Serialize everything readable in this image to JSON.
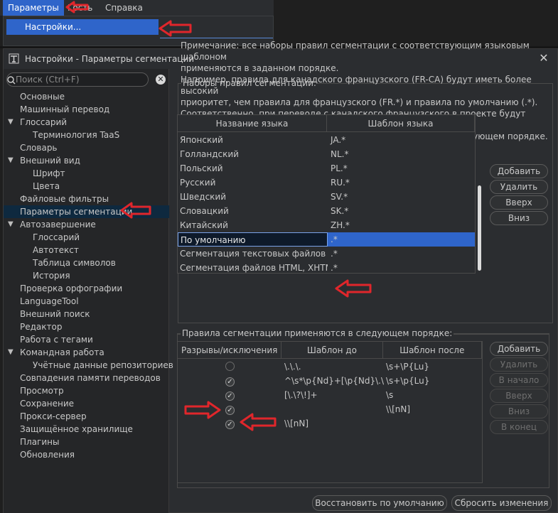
{
  "menubar": {
    "items": [
      "Параметры",
      "Гость",
      "Справка"
    ]
  },
  "menu_dropdown": {
    "item": "Настройки..."
  },
  "dialog": {
    "title": "Настройки - Параметры сегментации",
    "close_glyph": "✕"
  },
  "search": {
    "placeholder": "Поиск (Ctrl+F)"
  },
  "tree": [
    {
      "label": "Основные",
      "level": 0
    },
    {
      "label": "Машинный перевод",
      "level": 0
    },
    {
      "label": "Глоссарий",
      "level": 0,
      "expandable": true
    },
    {
      "label": "Терминология TaaS",
      "level": 1
    },
    {
      "label": "Словарь",
      "level": 0
    },
    {
      "label": "Внешний вид",
      "level": 0,
      "expandable": true
    },
    {
      "label": "Шрифт",
      "level": 1
    },
    {
      "label": "Цвета",
      "level": 1
    },
    {
      "label": "Файловые фильтры",
      "level": 0
    },
    {
      "label": "Параметры сегментации",
      "level": 0,
      "selected": true
    },
    {
      "label": "Автозавершение",
      "level": 0,
      "expandable": true
    },
    {
      "label": "Глоссарий",
      "level": 1
    },
    {
      "label": "Автотекст",
      "level": 1
    },
    {
      "label": "Таблица символов",
      "level": 1
    },
    {
      "label": "История",
      "level": 1
    },
    {
      "label": "Проверка орфографии",
      "level": 0
    },
    {
      "label": "LanguageTool",
      "level": 0
    },
    {
      "label": "Внешний поиск",
      "level": 0
    },
    {
      "label": "Редактор",
      "level": 0
    },
    {
      "label": "Работа с тегами",
      "level": 0
    },
    {
      "label": "Командная работа",
      "level": 0,
      "expandable": true
    },
    {
      "label": "Учётные данные репозиториев",
      "level": 1
    },
    {
      "label": "Совпадения памяти переводов",
      "level": 0
    },
    {
      "label": "Просмотр",
      "level": 0
    },
    {
      "label": "Сохранение",
      "level": 0
    },
    {
      "label": "Прокси-сервер",
      "level": 0
    },
    {
      "label": "Защищённое хранилище",
      "level": 0
    },
    {
      "label": "Плагины",
      "level": 0
    },
    {
      "label": "Обновления",
      "level": 0
    }
  ],
  "rulesets": {
    "legend": "Наборы правил сегментации:",
    "note": [
      "Примечание: все наборы правил сегментации с соответствующим языковым шаблоном",
      "применяются в заданном порядке.",
      "Например, правила для канадского французского (FR-CA) будут иметь более высокий",
      "приоритет, чем правила для французского (FR.*) и правила по умолчанию (.*).",
      "Соответственно, при переводе с канадского французского в проекте будут использоваться",
      "все правила, определённые для языковой цепочки в соответствующем порядке."
    ],
    "columns": [
      "Название языка",
      "Шаблон языка"
    ],
    "rows": [
      {
        "name": "Японский",
        "pattern": "JA.*"
      },
      {
        "name": "Голландский",
        "pattern": "NL.*"
      },
      {
        "name": "Польский",
        "pattern": "PL.*"
      },
      {
        "name": "Русский",
        "pattern": "RU.*"
      },
      {
        "name": "Шведский",
        "pattern": "SV.*"
      },
      {
        "name": "Словацкий",
        "pattern": "SK.*"
      },
      {
        "name": "Китайский",
        "pattern": "ZH.*"
      },
      {
        "name": "По умолчанию",
        "pattern": ".*",
        "selected": true
      },
      {
        "name": "Сегментация текстовых файлов",
        "pattern": ".*"
      },
      {
        "name": "Сегментация файлов HTML, XHTM...",
        "pattern": ".*"
      }
    ],
    "buttons": {
      "add": "Добавить",
      "remove": "Удалить",
      "up": "Вверх",
      "down": "Вниз"
    }
  },
  "rules": {
    "legend": "Правила сегментации применяются в следующем порядке:",
    "columns": [
      "Разрывы/исключения",
      "Шаблон до",
      "Шаблон после"
    ],
    "rows": [
      {
        "checked": false,
        "before": "\\.\\.\\.",
        "after": "\\s+\\P{Lu}"
      },
      {
        "checked": true,
        "before": "^\\s*\\p{Nd}+[\\p{Nd}\\.\\)...",
        "after": "\\s+\\p{Lu}"
      },
      {
        "checked": true,
        "before": "[\\.\\?\\!]+",
        "after": "\\s"
      },
      {
        "checked": true,
        "before": "",
        "after": "\\\\[nN]"
      },
      {
        "checked": true,
        "before": "\\\\[nN]",
        "after": ""
      }
    ],
    "buttons": {
      "add": "Добавить",
      "remove": "Удалить",
      "to_top": "В начало",
      "up": "Вверх",
      "down": "Вниз",
      "to_end": "В конец"
    }
  },
  "footer": {
    "restore_defaults": "Восстановить по умолчанию",
    "reset_changes": "Сбросить изменения"
  },
  "colors": {
    "accent": "#2f65ca",
    "annotation_arrow": "#e0262b",
    "selection_dark": "#0e293f"
  }
}
